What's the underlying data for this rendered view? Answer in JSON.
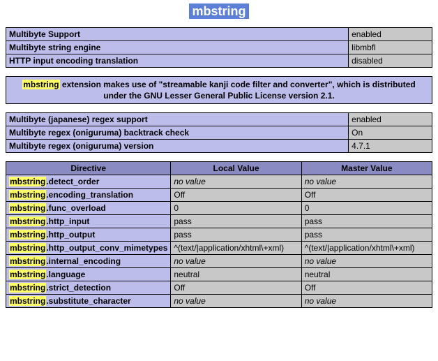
{
  "section_title": "mbstring",
  "info_table1": [
    {
      "name": "Multibyte Support",
      "value": "enabled"
    },
    {
      "name": "Multibyte string engine",
      "value": "libmbfl"
    },
    {
      "name": "HTTP input encoding translation",
      "value": "disabled"
    }
  ],
  "note": {
    "hl": "mbstring",
    "text_rest": " extension makes use of \"streamable kanji code filter and converter\", which is distributed under the GNU Lesser General Public License version 2.1."
  },
  "info_table2": [
    {
      "name": "Multibyte (japanese) regex support",
      "value": "enabled"
    },
    {
      "name": "Multibyte regex (oniguruma) backtrack check",
      "value": "On"
    },
    {
      "name": "Multibyte regex (oniguruma) version",
      "value": "4.7.1"
    }
  ],
  "directives": {
    "headers": {
      "directive": "Directive",
      "local": "Local Value",
      "master": "Master Value"
    },
    "rows": [
      {
        "hl": "mbstring",
        "rest": ".detect_order",
        "local": "no value",
        "master": "no value",
        "local_nv": true,
        "master_nv": true
      },
      {
        "hl": "mbstring",
        "rest": ".encoding_translation",
        "local": "Off",
        "master": "Off"
      },
      {
        "hl": "mbstring",
        "rest": ".func_overload",
        "local": "0",
        "master": "0"
      },
      {
        "hl": "mbstring",
        "rest": ".http_input",
        "local": "pass",
        "master": "pass"
      },
      {
        "hl": "mbstring",
        "rest": ".http_output",
        "local": "pass",
        "master": "pass"
      },
      {
        "hl": "mbstring",
        "rest": ".http_output_conv_mimetypes",
        "local": "^(text/|application/xhtml\\+xml)",
        "master": "^(text/|application/xhtml\\+xml)"
      },
      {
        "hl": "mbstring",
        "rest": ".internal_encoding",
        "local": "no value",
        "master": "no value",
        "local_nv": true,
        "master_nv": true
      },
      {
        "hl": "mbstring",
        "rest": ".language",
        "local": "neutral",
        "master": "neutral"
      },
      {
        "hl": "mbstring",
        "rest": ".strict_detection",
        "local": "Off",
        "master": "Off"
      },
      {
        "hl": "mbstring",
        "rest": ".substitute_character",
        "local": "no value",
        "master": "no value",
        "local_nv": true,
        "master_nv": true
      }
    ]
  }
}
